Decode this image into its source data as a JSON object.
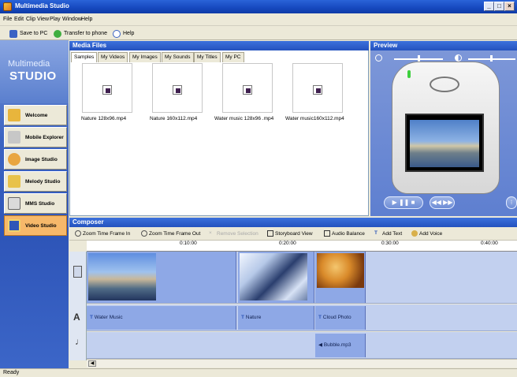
{
  "window": {
    "title": "Multimedia Studio"
  },
  "menu": [
    "File",
    "Edit",
    "Clip",
    "View",
    "Play",
    "Window",
    "Help"
  ],
  "toolbar": {
    "save": "Save to PC",
    "transfer": "Transfer to phone",
    "help": "Help"
  },
  "brand": {
    "line1": "Multimedia",
    "line2": "STUDIO"
  },
  "nav": [
    {
      "label": "Welcome"
    },
    {
      "label": "Mobile Explorer"
    },
    {
      "label": "Image Studio"
    },
    {
      "label": "Melody Studio"
    },
    {
      "label": "MMS Studio"
    },
    {
      "label": "Video Studio",
      "active": true
    }
  ],
  "media": {
    "title": "Media Files",
    "tabs": [
      "Samples",
      "My Videos",
      "My Images",
      "My Sounds",
      "My Titles",
      "My PC"
    ],
    "files": [
      "Nature 128x96.mp4",
      "Nature 160x112.mp4",
      "Water music 128x96 .mp4",
      "Water music160x112.mp4"
    ]
  },
  "preview": {
    "title": "Preview"
  },
  "composer": {
    "title": "Composer",
    "buttons": [
      "Zoom Time Frame In",
      "Zoom Time Frame Out",
      "Remove Selection",
      "Storyboard View",
      "Audio Balance",
      "Add Text",
      "Add Voice"
    ],
    "ruler": [
      "0:10:00",
      "0:20:00",
      "0:30:00",
      "0:40:00"
    ],
    "text_clips": [
      "Water Music",
      "Nature",
      "Cloud Photo"
    ],
    "audio_clips": [
      "Bubble.mp3"
    ]
  },
  "status": "Ready",
  "colors": {
    "title_bar": "#1648BE",
    "panel_header": "#2452BE",
    "active_nav": "#F6B86A",
    "track": "#8EA8E6"
  }
}
